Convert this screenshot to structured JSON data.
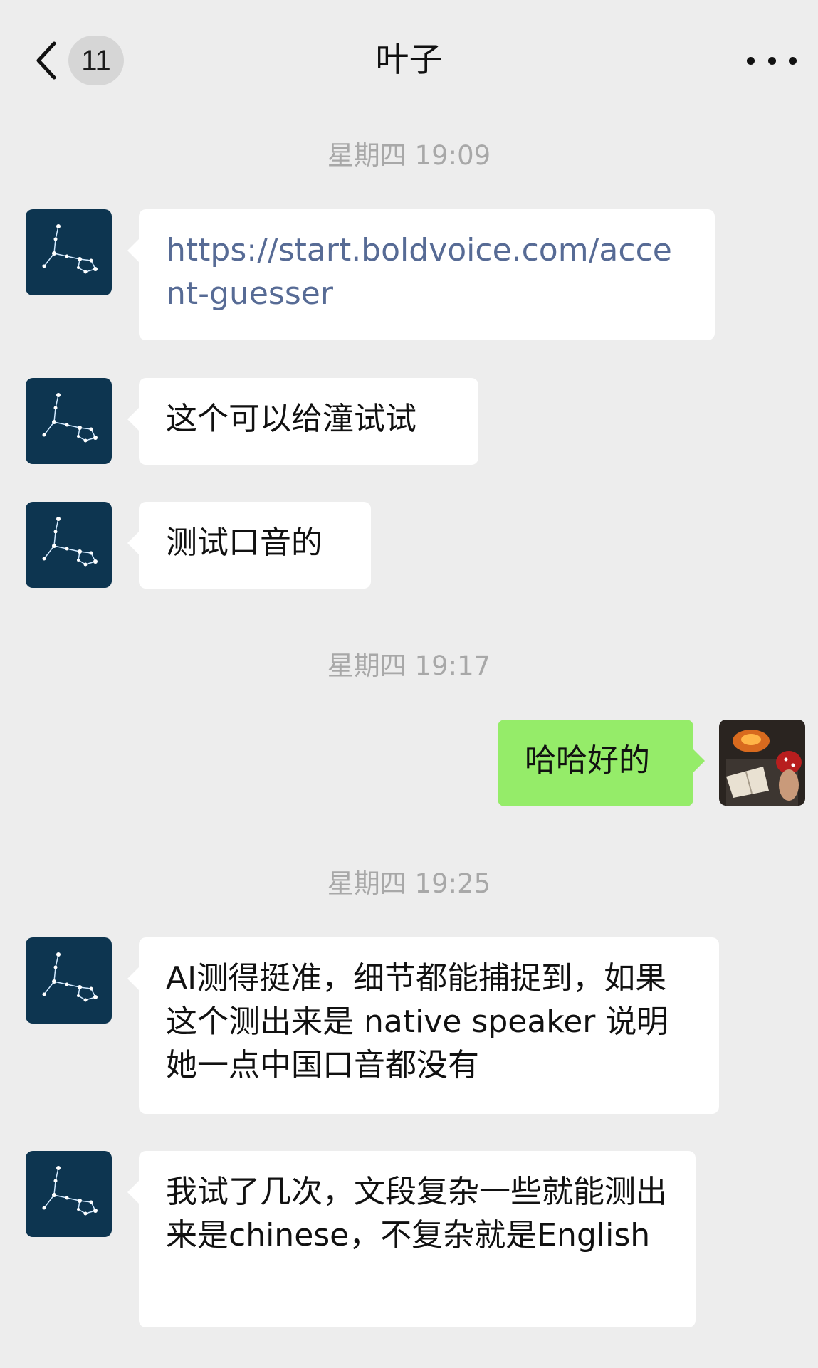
{
  "header": {
    "back_icon": "chevron-left-icon",
    "unread_count": "11",
    "title": "叶子",
    "more_icon": "more-dots-icon"
  },
  "messages": {
    "ts1": "星期四 19:09",
    "m1": "https://start.boldvoice.com/accent-guesser",
    "m2": "这个可以给潼试试",
    "m3": "测试口音的",
    "ts2": "星期四 19:17",
    "m4": "哈哈好的",
    "ts3": "星期四 19:25",
    "m5": "AI测得挺准，细节都能捕捉到，如果这个测出来是 native speaker 说明她一点中国口音都没有",
    "m6": "我试了几次，文段复杂一些就能测出来是chinese，不复杂就是English"
  },
  "colors": {
    "background": "#ededed",
    "incoming_bubble": "#ffffff",
    "outgoing_bubble": "#95ec69",
    "link": "#576b95",
    "timestamp": "#a8a8a8"
  }
}
